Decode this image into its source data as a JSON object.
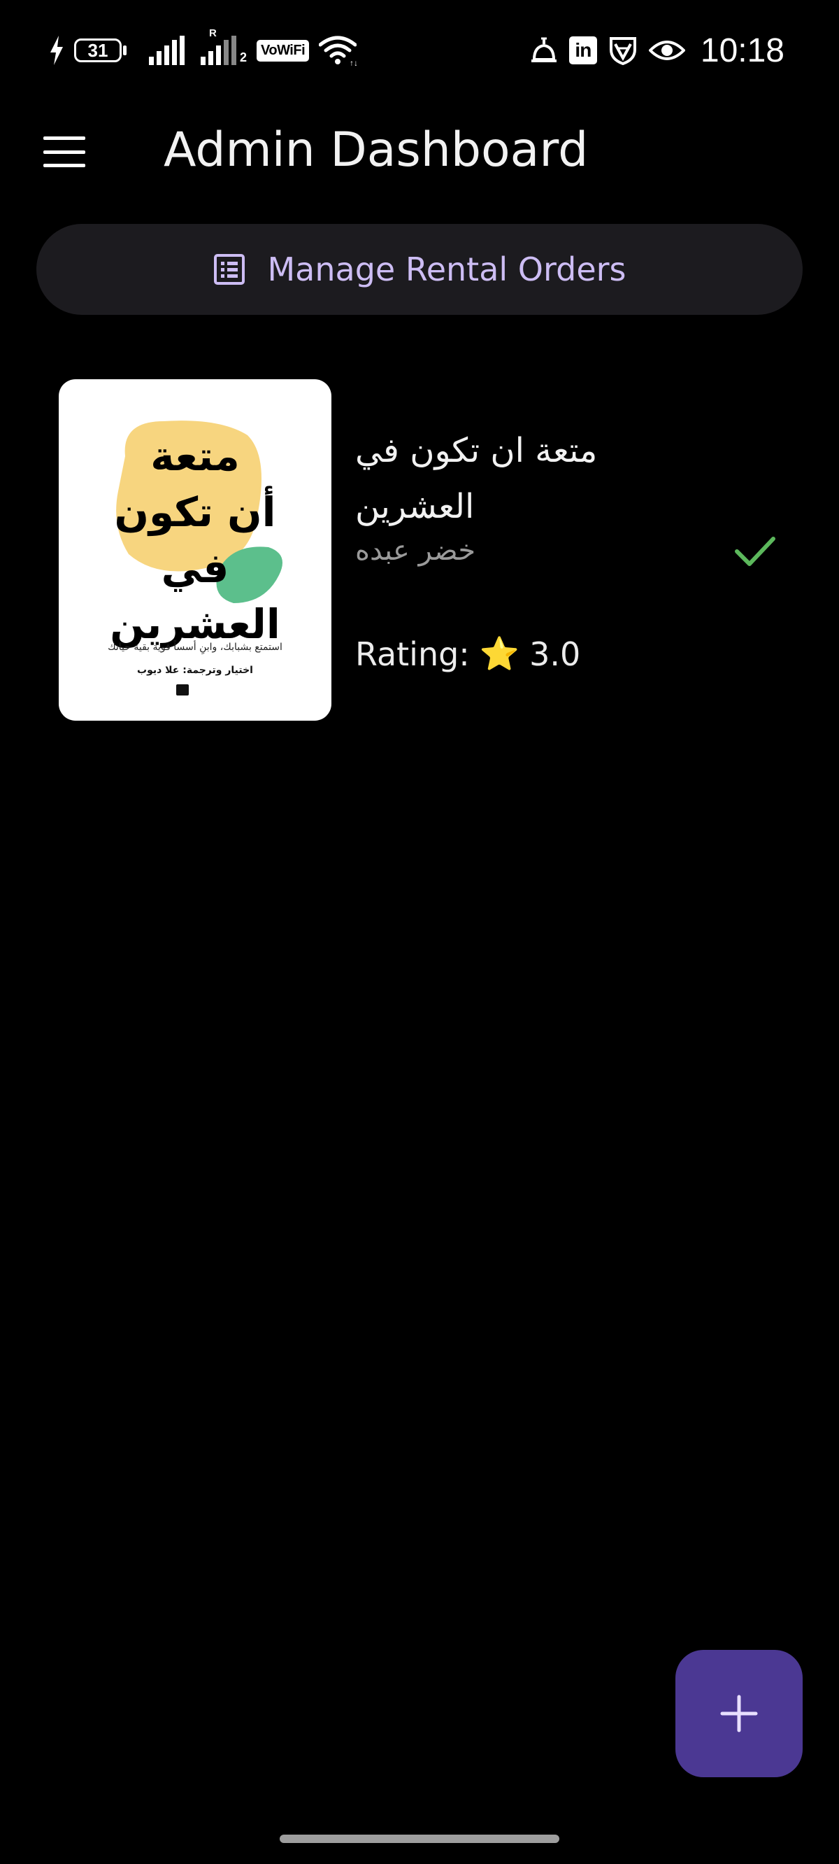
{
  "status_bar": {
    "battery_level": "31",
    "network_label": "VoWiFi",
    "roaming_indicator": "R",
    "sim_number": "2",
    "linkedin_label": "in",
    "time": "10:18",
    "icons": [
      "charging-bolt-icon",
      "battery-icon",
      "signal-icon",
      "signal-roaming-icon",
      "vowifi-icon",
      "wifi-icon",
      "alarm-icon",
      "linkedin-icon",
      "vpn-shield-icon",
      "eye-icon"
    ]
  },
  "app_bar": {
    "title": "Admin Dashboard",
    "menu_icon": "hamburger-menu-icon"
  },
  "actions": {
    "manage_orders_label": "Manage Rental Orders",
    "manage_orders_icon": "list-alt-icon"
  },
  "books": [
    {
      "title": "متعة ان تكون في العشرين",
      "author": "خضر عبده",
      "rating_label": "Rating:",
      "rating_star": "⭐",
      "rating_value": "3.0",
      "status_icon": "check-icon",
      "cover": {
        "title_lines": [
          "متعة",
          "أن تكون",
          "في",
          "العشرين"
        ],
        "subtitle": "استمتع بشبابك، وابنِ أسساً قوية بقية حياتك",
        "translator": "اختيار وترجمة: علا ديوب",
        "blob_yellow": "#f7d57f",
        "blob_green": "#5cbf8c"
      }
    }
  ],
  "fab": {
    "icon": "plus-icon",
    "color": "#4b3893"
  },
  "colors": {
    "background": "#000000",
    "accent": "#cdbdf4",
    "button_surface": "#1c1b1f",
    "check": "#5cb85c"
  }
}
